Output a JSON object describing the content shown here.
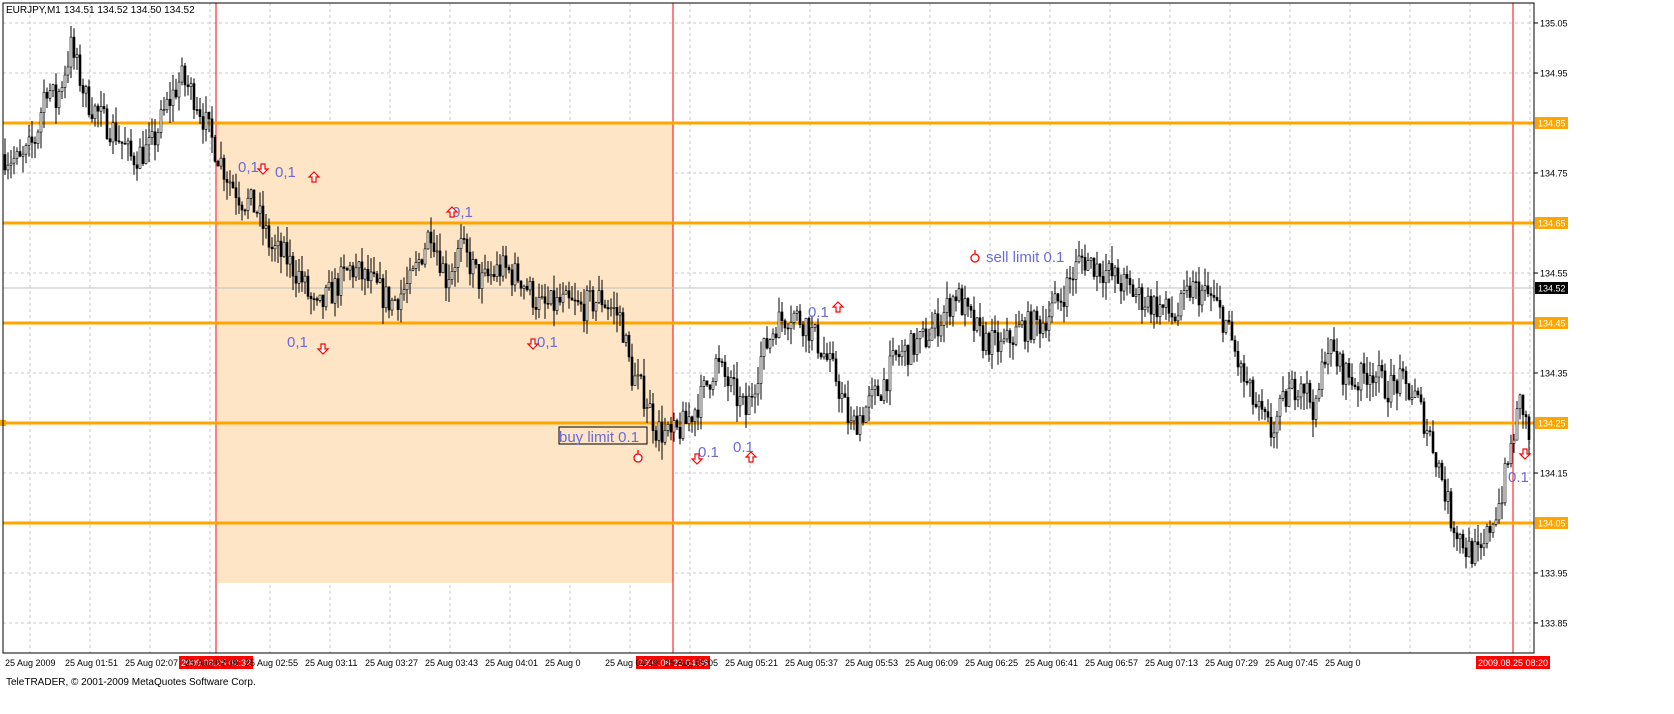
{
  "header": {
    "symbol": "EURJPY,M1",
    "ohlc": "134.51 134.52 134.50 134.52"
  },
  "copyright": "TeleTRADER, © 2001-2009 MetaQuotes Software Corp.",
  "colors": {
    "background": "#ffffff",
    "grid": "#c8c8c8",
    "level_line": "#ffa500",
    "vertical_line": "#ff0000",
    "rectangle_fill": "#fde5c6",
    "candle": "#000000",
    "annotation_text": "#6b6bd6",
    "arrow": "#ff0000",
    "current_price_bg": "#000000"
  },
  "chart_data": {
    "type": "candlestick",
    "title": "EURJPY,M1",
    "ylim": [
      133.79,
      135.09
    ],
    "y_ticks": [
      "135.05",
      "134.95",
      "134.75",
      "134.55",
      "134.35",
      "134.15",
      "133.95",
      "133.85"
    ],
    "x_tick_labels": [
      "25 Aug 2009",
      "25 Aug 01:51",
      "25 Aug 02:07",
      "25 Aug 02:39",
      "25 Aug 02:55",
      "25 Aug 03:11",
      "25 Aug 03:27",
      "25 Aug 03:43",
      "25 Aug 04:01",
      "25 Aug 0",
      "25 Aug 04:49",
      "25 Aug 05:05",
      "25 Aug 05:21",
      "25 Aug 05:37",
      "25 Aug 05:53",
      "25 Aug 06:09",
      "25 Aug 06:25",
      "25 Aug 06:41",
      "25 Aug 06:57",
      "25 Aug 07:13",
      "25 Aug 07:29",
      "25 Aug 07:45",
      "25 Aug 0"
    ],
    "price_path": [
      [
        0,
        134.79
      ],
      [
        20,
        134.77
      ],
      [
        35,
        134.82
      ],
      [
        45,
        134.93
      ],
      [
        55,
        134.89
      ],
      [
        70,
        135.0
      ],
      [
        85,
        134.9
      ],
      [
        100,
        134.86
      ],
      [
        115,
        134.83
      ],
      [
        130,
        134.78
      ],
      [
        150,
        134.8
      ],
      [
        165,
        134.88
      ],
      [
        180,
        134.94
      ],
      [
        195,
        134.9
      ],
      [
        210,
        134.82
      ],
      [
        225,
        134.75
      ],
      [
        240,
        134.7
      ],
      [
        255,
        134.68
      ],
      [
        270,
        134.6
      ],
      [
        285,
        134.58
      ],
      [
        300,
        134.54
      ],
      [
        315,
        134.47
      ],
      [
        330,
        134.51
      ],
      [
        350,
        134.56
      ],
      [
        370,
        134.53
      ],
      [
        390,
        134.49
      ],
      [
        410,
        134.53
      ],
      [
        430,
        134.64
      ],
      [
        445,
        134.54
      ],
      [
        460,
        134.6
      ],
      [
        480,
        134.53
      ],
      [
        500,
        134.56
      ],
      [
        520,
        134.54
      ],
      [
        540,
        134.48
      ],
      [
        560,
        134.49
      ],
      [
        580,
        134.48
      ],
      [
        600,
        134.5
      ],
      [
        620,
        134.46
      ],
      [
        630,
        134.35
      ],
      [
        645,
        134.3
      ],
      [
        655,
        134.24
      ],
      [
        670,
        134.22
      ],
      [
        685,
        134.25
      ],
      [
        700,
        134.3
      ],
      [
        715,
        134.37
      ],
      [
        730,
        134.32
      ],
      [
        745,
        134.27
      ],
      [
        760,
        134.38
      ],
      [
        775,
        134.45
      ],
      [
        790,
        134.47
      ],
      [
        805,
        134.45
      ],
      [
        820,
        134.4
      ],
      [
        835,
        134.34
      ],
      [
        850,
        134.24
      ],
      [
        865,
        134.28
      ],
      [
        880,
        134.32
      ],
      [
        895,
        134.38
      ],
      [
        910,
        134.4
      ],
      [
        925,
        134.42
      ],
      [
        940,
        134.46
      ],
      [
        955,
        134.51
      ],
      [
        965,
        134.47
      ],
      [
        980,
        134.42
      ],
      [
        1000,
        134.4
      ],
      [
        1020,
        134.44
      ],
      [
        1040,
        134.45
      ],
      [
        1060,
        134.5
      ],
      [
        1080,
        134.58
      ],
      [
        1100,
        134.56
      ],
      [
        1120,
        134.53
      ],
      [
        1140,
        134.5
      ],
      [
        1160,
        134.48
      ],
      [
        1175,
        134.46
      ],
      [
        1190,
        134.52
      ],
      [
        1210,
        134.5
      ],
      [
        1225,
        134.45
      ],
      [
        1240,
        134.35
      ],
      [
        1255,
        134.28
      ],
      [
        1270,
        134.23
      ],
      [
        1285,
        134.3
      ],
      [
        1300,
        134.34
      ],
      [
        1315,
        134.27
      ],
      [
        1325,
        134.41
      ],
      [
        1340,
        134.36
      ],
      [
        1355,
        134.33
      ],
      [
        1370,
        134.36
      ],
      [
        1385,
        134.32
      ],
      [
        1400,
        134.33
      ],
      [
        1415,
        134.3
      ],
      [
        1430,
        134.22
      ],
      [
        1440,
        134.15
      ],
      [
        1450,
        134.06
      ],
      [
        1465,
        134.0
      ],
      [
        1480,
        133.98
      ],
      [
        1490,
        134.05
      ],
      [
        1500,
        134.1
      ],
      [
        1510,
        134.2
      ],
      [
        1520,
        134.3
      ],
      [
        1528,
        134.22
      ]
    ],
    "levels": [
      {
        "value": 134.85,
        "label": "134.85"
      },
      {
        "value": 134.65,
        "label": "134.65"
      },
      {
        "value": 134.45,
        "label": "134.45"
      },
      {
        "value": 134.25,
        "label": "134.25"
      },
      {
        "value": 134.05,
        "label": "134.05"
      }
    ],
    "current_price": {
      "value": 134.52,
      "label": "134.52"
    },
    "vertical_lines": [
      {
        "x_label": "2009.08.25 02:32"
      },
      {
        "x_label": "2009.08.25 04:36"
      },
      {
        "x_label": "2009.08.25 08:20"
      }
    ],
    "rectangle": {
      "from": "2009.08.25 02:32",
      "to": "2009.08.25 04:36",
      "price_top": 134.85,
      "price_bottom": 133.93
    },
    "annotations": [
      {
        "text": "0,1",
        "price": 134.76
      },
      {
        "text": "0,1",
        "price": 134.75
      },
      {
        "text": "0,1",
        "price": 134.67
      },
      {
        "text": "0,1",
        "price": 134.41
      },
      {
        "text": "0,1",
        "price": 134.41
      },
      {
        "text": "0.1",
        "price": 134.47
      },
      {
        "text": "sell limit 0.1",
        "price": 134.58
      },
      {
        "text": "buy limit 0.1",
        "price": 134.22
      },
      {
        "text": "0.1",
        "price": 134.19
      },
      {
        "text": "0.1",
        "price": 134.2
      },
      {
        "text": "0.1",
        "price": 134.14
      }
    ],
    "arrows": [
      {
        "dir": "down",
        "price": 134.76
      },
      {
        "dir": "up",
        "price": 134.74
      },
      {
        "dir": "up",
        "price": 134.67
      },
      {
        "dir": "down",
        "price": 134.4
      },
      {
        "dir": "down",
        "price": 134.41
      },
      {
        "dir": "up",
        "price": 134.48
      },
      {
        "dir": "down",
        "price": 134.18
      },
      {
        "dir": "up",
        "price": 134.18
      },
      {
        "dir": "down",
        "price": 134.19
      }
    ],
    "pending_markers": [
      {
        "label": "sell limit",
        "price": 134.58
      },
      {
        "label": "buy limit",
        "price": 134.18
      }
    ]
  }
}
